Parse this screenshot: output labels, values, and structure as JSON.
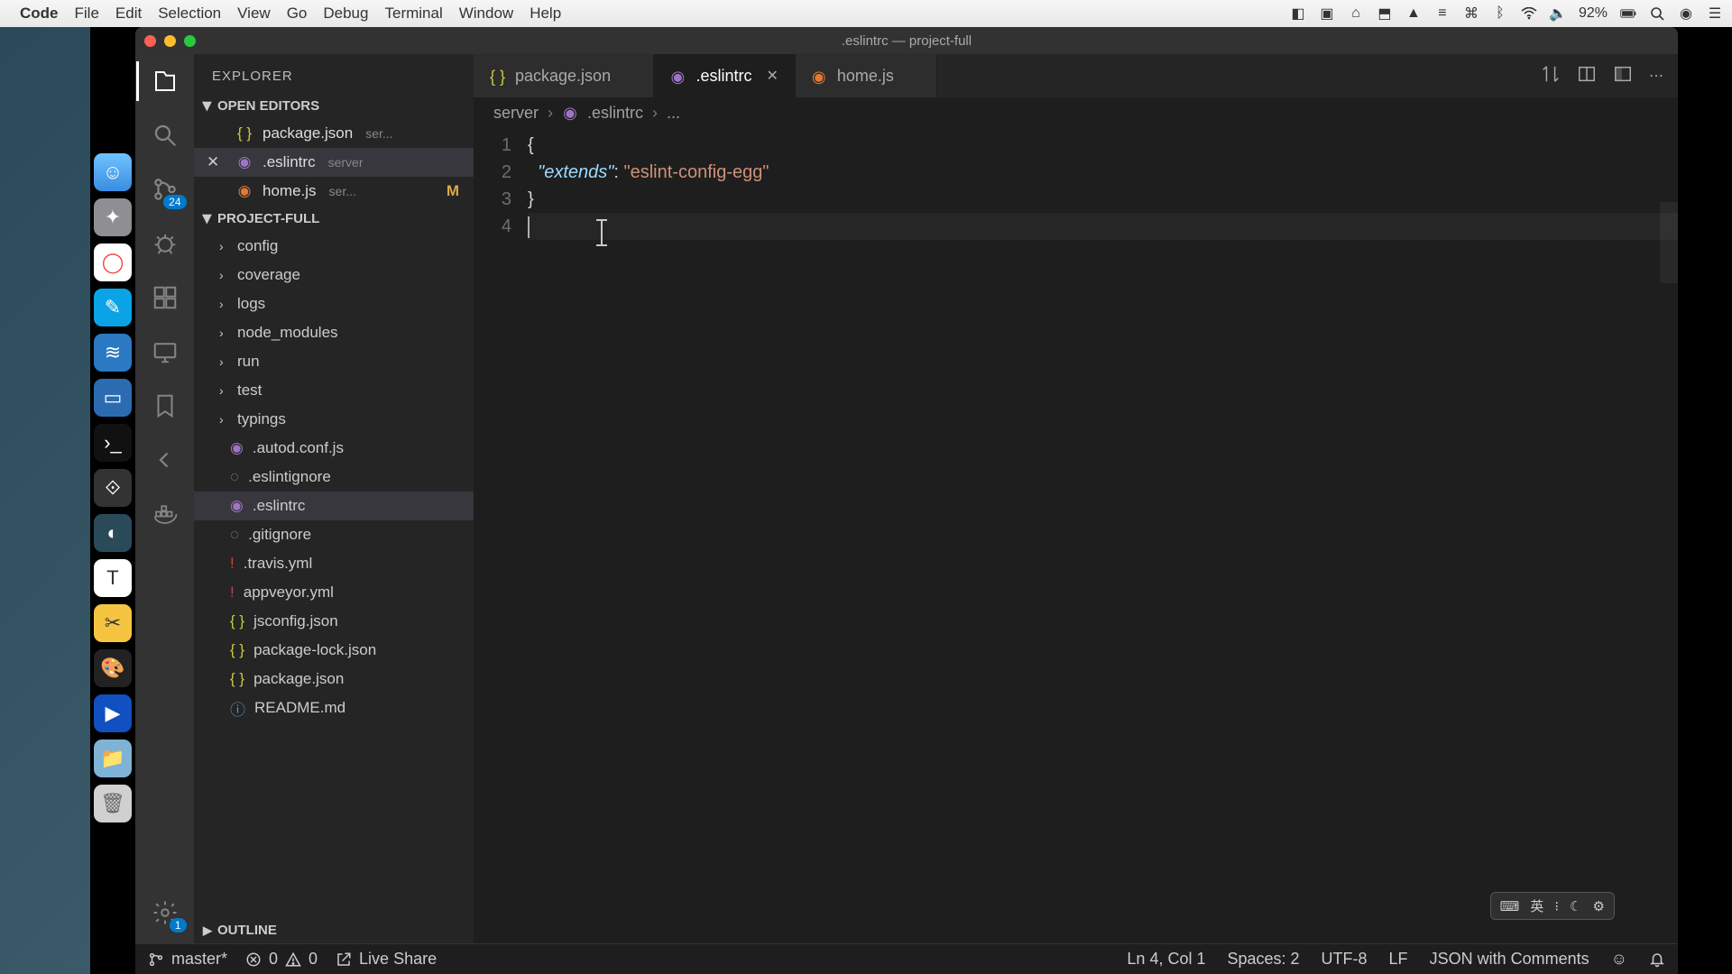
{
  "menubar": {
    "app": "Code",
    "items": [
      "File",
      "Edit",
      "Selection",
      "View",
      "Go",
      "Debug",
      "Terminal",
      "Window",
      "Help"
    ],
    "battery": "92%"
  },
  "window": {
    "title": ".eslintrc — project-full"
  },
  "activity": {
    "scm_badge": "24",
    "settings_badge": "1"
  },
  "sidebar": {
    "title": "EXPLORER",
    "open_editors_label": "OPEN EDITORS",
    "open_editors": [
      {
        "name": "package.json",
        "path": "ser...",
        "icon": "json",
        "modified": false,
        "active": false
      },
      {
        "name": ".eslintrc",
        "path": "server",
        "icon": "config",
        "modified": false,
        "active": true
      },
      {
        "name": "home.js",
        "path": "ser...",
        "icon": "js",
        "modified": true,
        "active": false
      }
    ],
    "project_label": "PROJECT-FULL",
    "folders": [
      "config",
      "coverage",
      "logs",
      "node_modules",
      "run",
      "test",
      "typings"
    ],
    "files": [
      {
        "name": ".autod.conf.js",
        "icon": "config"
      },
      {
        "name": ".eslintignore",
        "icon": "grey"
      },
      {
        "name": ".eslintrc",
        "icon": "config",
        "selected": true
      },
      {
        "name": ".gitignore",
        "icon": "grey"
      },
      {
        "name": ".travis.yml",
        "icon": "yml"
      },
      {
        "name": "appveyor.yml",
        "icon": "yml"
      },
      {
        "name": "jsconfig.json",
        "icon": "json"
      },
      {
        "name": "package-lock.json",
        "icon": "json"
      },
      {
        "name": "package.json",
        "icon": "json"
      },
      {
        "name": "README.md",
        "icon": "md"
      }
    ],
    "outline_label": "OUTLINE"
  },
  "tabs": [
    {
      "name": "package.json",
      "icon": "json",
      "active": false
    },
    {
      "name": ".eslintrc",
      "icon": "config",
      "active": true
    },
    {
      "name": "home.js",
      "icon": "js",
      "active": false
    }
  ],
  "breadcrumb": {
    "root": "server",
    "file": ".eslintrc",
    "tail": "..."
  },
  "code": {
    "lines": [
      "1",
      "2",
      "3",
      "4"
    ],
    "l1": "{",
    "l2_key": "\"extends\"",
    "l2_sep": ": ",
    "l2_val": "\"eslint-config-egg\"",
    "l3": "}",
    "l4": ""
  },
  "status": {
    "branch": "master*",
    "errors": "0",
    "warnings": "0",
    "liveshare": "Live Share",
    "position": "Ln 4, Col 1",
    "spaces": "Spaces: 2",
    "encoding": "UTF-8",
    "eol": "LF",
    "lang": "JSON with Comments"
  },
  "ime": {
    "lang": "英"
  }
}
